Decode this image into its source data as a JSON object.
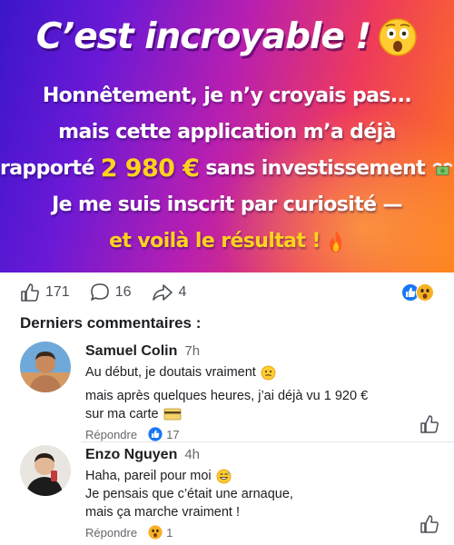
{
  "banner": {
    "title": "C’est incroyable !",
    "line1": "Honnêtement, je n’y croyais pas...",
    "line2": "mais cette application m’a déjà",
    "line3_before": "rapporté",
    "line3_amount": "2 980 €",
    "line3_after": "sans investissement",
    "line4": "Je me suis inscrit par curiosité —",
    "line5": "et voilà le résultat !",
    "icons": [
      "shocked-face-emoji",
      "money-with-wings-emoji",
      "fire-emoji"
    ]
  },
  "reactions": {
    "likes": "171",
    "comments": "16",
    "shares": "4",
    "icons": [
      "like-icon",
      "wow-react-icon"
    ]
  },
  "section_title": "Derniers commentaires :",
  "comments": [
    {
      "name": "Samuel Colin",
      "time": "7h",
      "line1": "Au début, je doutais vraiment",
      "line2": "mais après quelques heures, j’ai déjà vu 1 920 €",
      "line3": "sur ma carte",
      "reply": "Répondre",
      "reactions": "17"
    },
    {
      "name": "Enzo Nguyen",
      "time": "4h",
      "line1": "Haha, pareil pour moi",
      "line2": "Je pensais que c’était une arnaque,",
      "line3": "mais ça marche vraiment !",
      "reply": "Répondre",
      "reactions": "1"
    }
  ],
  "colors": {
    "accent_blue": "#1877f2",
    "banner_yellow": "#ffd21f",
    "text_grey": "#65676b"
  }
}
